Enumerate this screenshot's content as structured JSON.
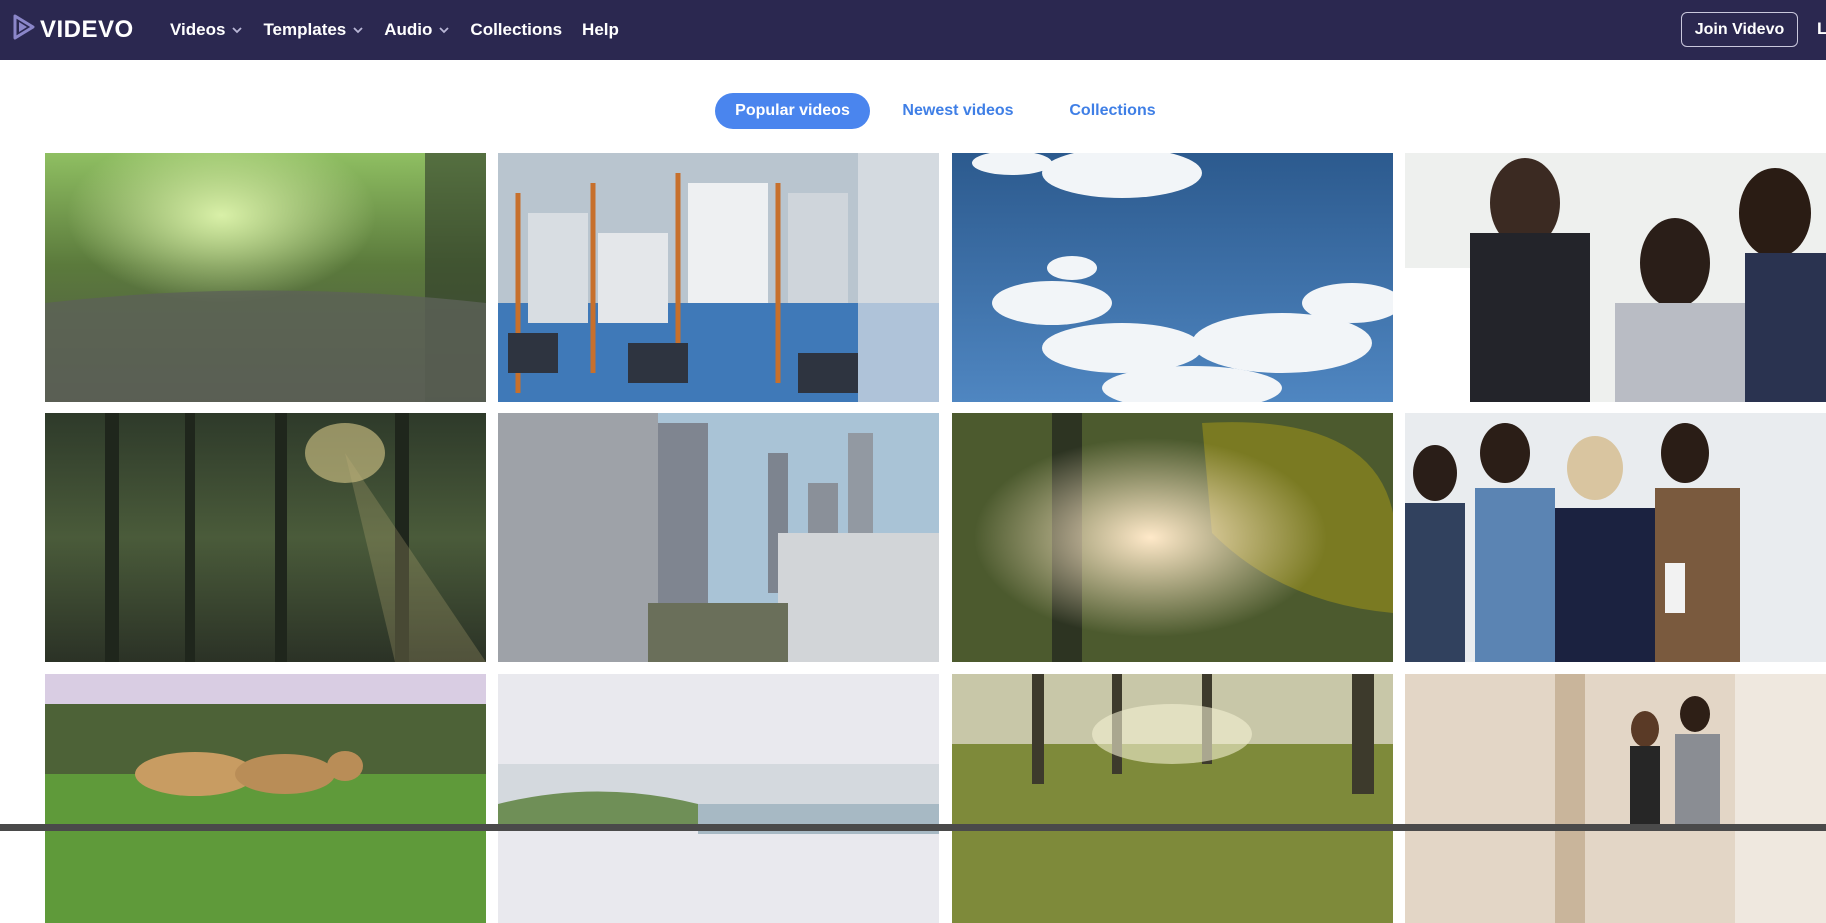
{
  "brand": {
    "name": "VIDEVO",
    "icon": "play-triangle-logo-icon"
  },
  "nav": {
    "items": [
      {
        "label": "Videos",
        "dropdown": true
      },
      {
        "label": "Templates",
        "dropdown": true
      },
      {
        "label": "Audio",
        "dropdown": true
      },
      {
        "label": "Collections",
        "dropdown": false
      },
      {
        "label": "Help",
        "dropdown": false
      }
    ],
    "join_label": "Join Videvo",
    "edge_text": "L"
  },
  "tabs": [
    {
      "label": "Popular videos",
      "active": true
    },
    {
      "label": "Newest videos",
      "active": false
    },
    {
      "label": "Collections",
      "active": false
    }
  ],
  "thumbnails": [
    {
      "row": 1,
      "col": 1,
      "subject": "forest path with bokeh light"
    },
    {
      "row": 1,
      "col": 2,
      "subject": "industrial machinery"
    },
    {
      "row": 1,
      "col": 3,
      "subject": "blue sky with clouds"
    },
    {
      "row": 1,
      "col": 4,
      "subject": "business team at laptop"
    },
    {
      "row": 2,
      "col": 1,
      "subject": "sunlit pine forest"
    },
    {
      "row": 2,
      "col": 2,
      "subject": "city skyline aerial"
    },
    {
      "row": 2,
      "col": 3,
      "subject": "sun through leaves"
    },
    {
      "row": 2,
      "col": 4,
      "subject": "colleagues meeting"
    },
    {
      "row": 3,
      "col": 1,
      "subject": "lioness walking in grass"
    },
    {
      "row": 3,
      "col": 2,
      "subject": "hazy coastline"
    },
    {
      "row": 3,
      "col": 3,
      "subject": "forest meadow sunlight"
    },
    {
      "row": 3,
      "col": 4,
      "subject": "two people walking in office"
    }
  ],
  "colors": {
    "header_bg": "#2b2850",
    "accent": "#4a85ee",
    "tab_text": "#3f7fe6"
  }
}
